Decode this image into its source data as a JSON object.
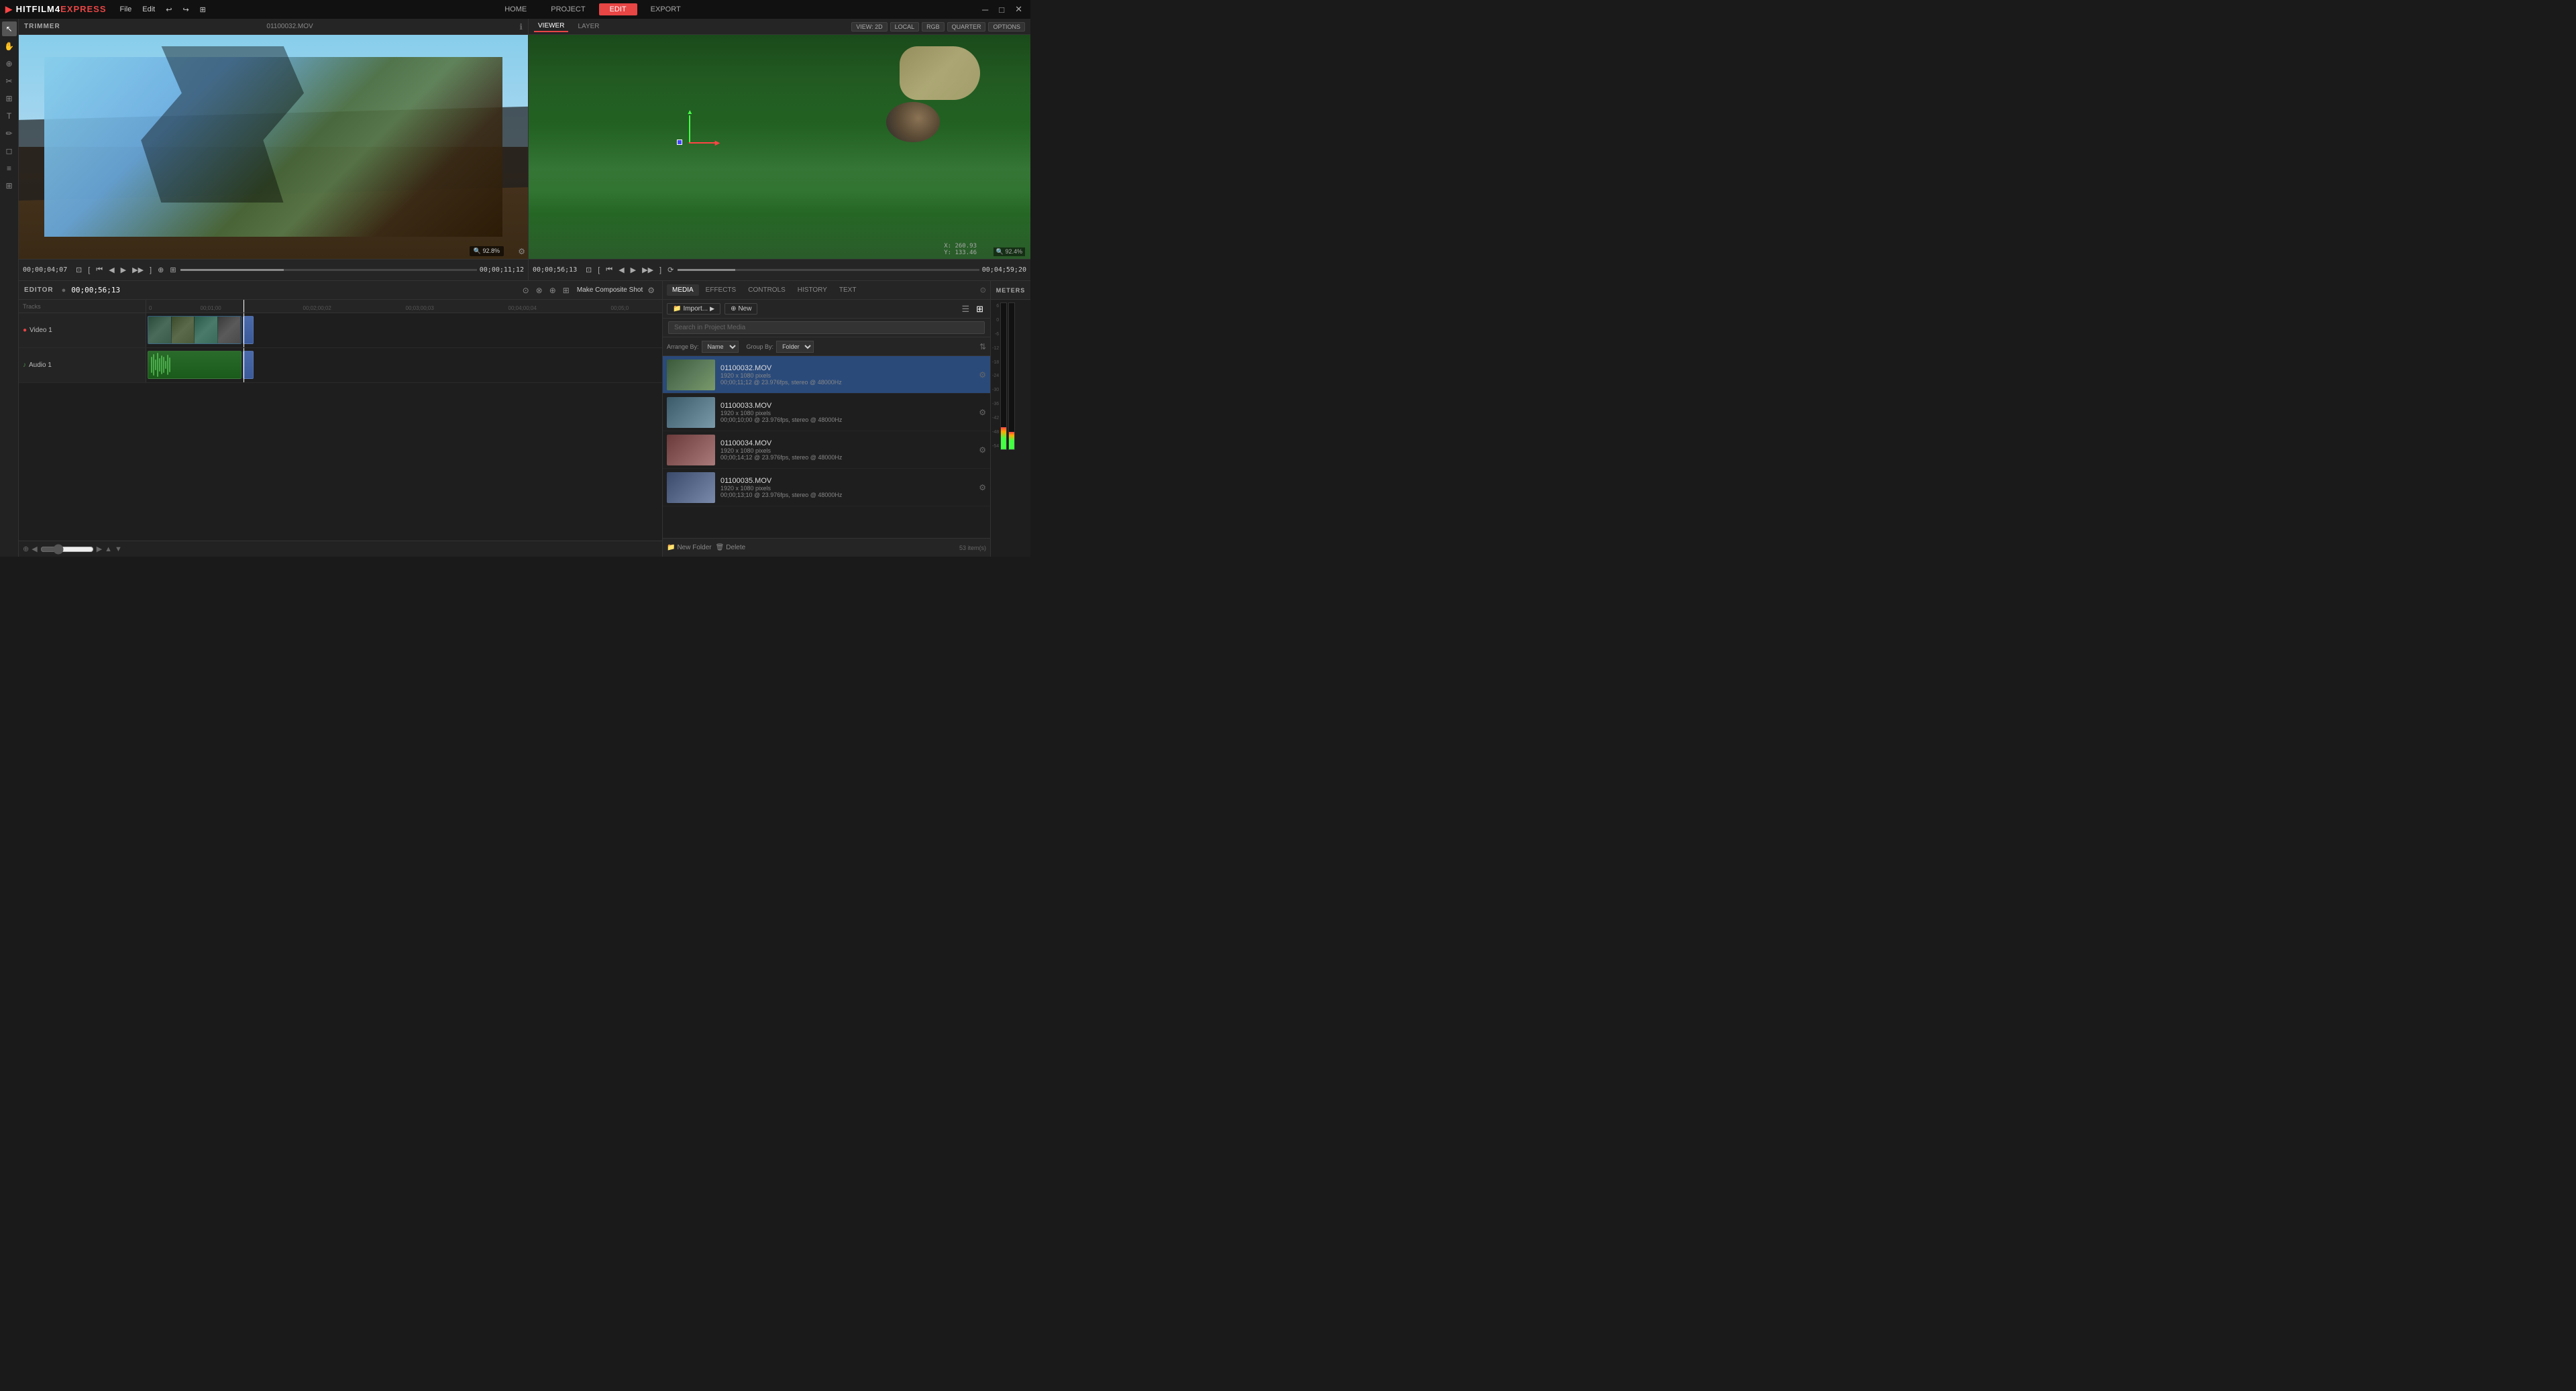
{
  "app": {
    "name": "HITFILM4",
    "name_suffix": "EXPRESS",
    "menu": [
      "File",
      "Edit"
    ],
    "nav_buttons": [
      "HOME",
      "PROJECT",
      "EDIT",
      "EXPORT"
    ],
    "active_nav": "EDIT",
    "window_controls": [
      "─",
      "□",
      "✕"
    ]
  },
  "trimmer": {
    "title": "TRIMMER",
    "filename": "01100032.MOV",
    "zoom": "92.8%",
    "current_time": "00;00;04;07",
    "end_time": "00;00;11;12"
  },
  "viewer": {
    "title": "VIEWER",
    "tabs": [
      "VIEWER",
      "LAYER"
    ],
    "active_tab": "VIEWER",
    "options": [
      "VIEW: 2D",
      "LOCAL",
      "RGB",
      "QUARTER",
      "OPTIONS"
    ],
    "zoom": "92.4%",
    "coords_x": "X: 260.93",
    "coords_y": "Y: 133.46",
    "current_time": "00;00;56;13",
    "end_time": "00;04;59;20"
  },
  "editor": {
    "title": "EDITOR",
    "current_time": "00;00;56;13",
    "make_composite_label": "Make Composite Shot",
    "tracks": [
      {
        "name": "Video 1",
        "icon": "▶",
        "type": "video"
      },
      {
        "name": "Audio 1",
        "icon": "♪",
        "type": "audio"
      }
    ],
    "ruler_marks": [
      "0",
      "00;01;00",
      "00;02;00;02",
      "00;03;00;03",
      "00;04;00;04",
      "00;05;0"
    ]
  },
  "media": {
    "tabs": [
      "MEDIA",
      "EFFECTS",
      "CONTROLS",
      "HISTORY",
      "TEXT"
    ],
    "active_tab": "MEDIA",
    "import_label": "Import...",
    "new_label": "New",
    "search_placeholder": "Search in Project Media",
    "sort_by_label": "Arrange By:",
    "sort_by_value": "Name",
    "group_by_label": "Group By:",
    "group_by_value": "Folder",
    "items": [
      {
        "name": "01100032.MOV",
        "size": "1920 x 1080 pixels",
        "info": "00;00;11;12 @ 23.976fps, stereo @ 48000Hz",
        "selected": true
      },
      {
        "name": "01100033.MOV",
        "size": "1920 x 1080 pixels",
        "info": "00;00;10;00 @ 23.976fps, stereo @ 48000Hz",
        "selected": false
      },
      {
        "name": "01100034.MOV",
        "size": "1920 x 1080 pixels",
        "info": "00;00;14;12 @ 23.976fps, stereo @ 48000Hz",
        "selected": false
      },
      {
        "name": "01100035.MOV",
        "size": "1920 x 1080 pixels",
        "info": "00;00;13;10 @ 23.976fps, stereo @ 48000Hz",
        "selected": false
      }
    ],
    "footer": {
      "new_folder_label": "New Folder",
      "delete_label": "Delete",
      "count": "53 item(s)"
    }
  },
  "meters": {
    "title": "METERS",
    "labels": [
      "6",
      "0",
      "-6",
      "-12",
      "-18",
      "-24",
      "-30",
      "-36",
      "-42",
      "-48",
      "-54",
      "-60"
    ]
  },
  "colors": {
    "accent": "#e84545",
    "selected_bg": "#2a4a7a",
    "video_clip": "#2a5a7a",
    "audio_clip": "#2a6a2a"
  }
}
